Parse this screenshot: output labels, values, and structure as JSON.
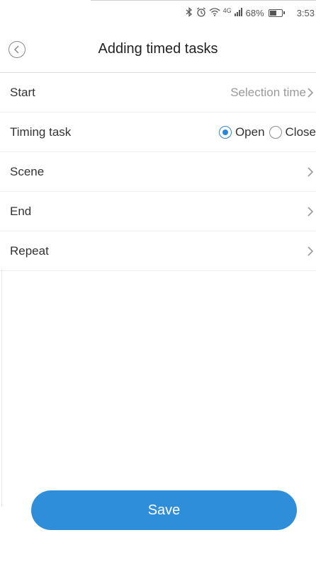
{
  "status_bar": {
    "icons": [
      "bluetooth-icon",
      "alarm-icon",
      "wifi-icon",
      "signal-icon"
    ],
    "network": "4G",
    "battery": "68%",
    "time": "3:53"
  },
  "header": {
    "title": "Adding timed tasks",
    "back_icon": "back-icon"
  },
  "rows": {
    "start": {
      "label": "Start",
      "value": "Selection time"
    },
    "timing_task": {
      "label": "Timing task",
      "options": [
        {
          "label": "Open",
          "selected": true
        },
        {
          "label": "Close",
          "selected": false
        }
      ]
    },
    "scene": {
      "label": "Scene"
    },
    "end": {
      "label": "End"
    },
    "repeat": {
      "label": "Repeat"
    }
  },
  "save_label": "Save",
  "colors": {
    "accent": "#2e8ed9",
    "radio_active": "#2f86d6"
  }
}
